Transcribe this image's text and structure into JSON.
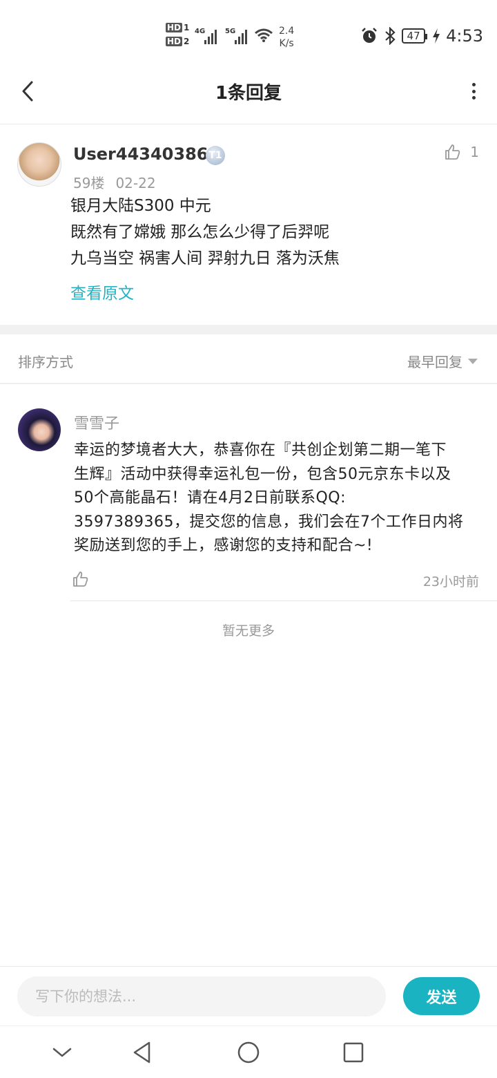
{
  "status_bar": {
    "hd1": "HD",
    "sim1": "1",
    "hd2": "HD",
    "sim2": "2",
    "net1": "4G",
    "net2": "5G",
    "speed_value": "2.4",
    "speed_unit": "K/s",
    "battery": "47",
    "time": "4:53"
  },
  "header": {
    "title": "1条回复"
  },
  "main_comment": {
    "username": "User443403869",
    "level_badge": "T1",
    "floor": "59楼",
    "date": "02-22",
    "like_count": "1",
    "lines": [
      "银月大陆S300 中元",
      "既然有了嫦娥 那么怎么少得了后羿呢",
      "九乌当空 祸害人间 羿射九日 落为沃焦"
    ],
    "view_original": "查看原文"
  },
  "sort": {
    "label": "排序方式",
    "selected": "最早回复"
  },
  "reply": {
    "username": "雪雪子",
    "body_lines": [
      "幸运的梦境者大大，恭喜你在『共创企划第二期一笔下",
      "生辉』活动中获得幸运礼包一份，包含50元京东卡以及",
      "50个高能晶石！请在4月2日前联系QQ:",
      "3597389365，提交您的信息，我们会在7个工作日内将",
      "奖励送到您的手上，感谢您的支持和配合~!"
    ],
    "time": "23小时前"
  },
  "footer_note": "暂无更多",
  "input": {
    "placeholder": "写下你的想法...",
    "send_label": "发送"
  },
  "colors": {
    "accent": "#1ab3c2",
    "link": "#26b2c3"
  }
}
